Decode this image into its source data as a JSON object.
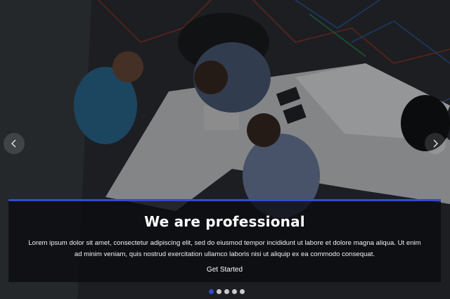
{
  "slider": {
    "slide_title": "We are professional",
    "slide_text": "Lorem ipsum dolor sit amet, consectetur adipiscing elit, sed do eiusmod tempor incididunt ut labore et dolore magna aliqua. Ut enim ad minim veniam, quis nostrud exercitation ullamco laboris nisi ut aliquip ex ea commodo consequat.",
    "cta_label": "Get Started",
    "prev_icon": "chevron-left-icon",
    "next_icon": "chevron-right-icon",
    "dots": [
      {
        "active": true
      },
      {
        "active": false
      },
      {
        "active": false
      },
      {
        "active": false
      },
      {
        "active": false
      }
    ],
    "accent_color": "#2f4bd6"
  }
}
